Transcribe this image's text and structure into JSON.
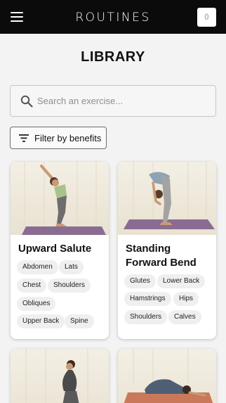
{
  "header": {
    "title": "ROUTINES",
    "counter": "0"
  },
  "page": {
    "title": "LIBRARY"
  },
  "search": {
    "placeholder": "Search an exercise..."
  },
  "filter": {
    "label": "Filter by benefits"
  },
  "exercises": [
    {
      "name": "Upward Salute",
      "benefits": [
        "Abdomen",
        "Lats",
        "Chest",
        "Shoulders",
        "Obliques",
        "Upper Back",
        "Spine"
      ]
    },
    {
      "name": "Standing Forward Bend",
      "benefits": [
        "Glutes",
        "Lower Back",
        "Hamstrings",
        "Hips",
        "Shoulders",
        "Calves"
      ]
    }
  ],
  "colors": {
    "header_bg": "#0b0b0b",
    "mat_purple": "#8a6c93",
    "mat_orange": "#c9795a"
  }
}
